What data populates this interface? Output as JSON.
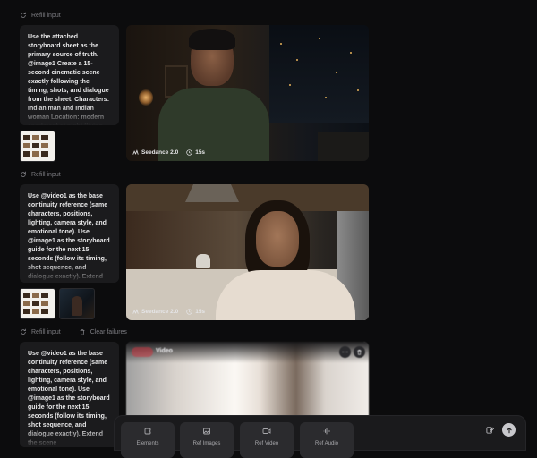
{
  "refill_label": "Refill input",
  "clear_failures_label": "Clear failures",
  "generations": [
    {
      "prompt": "Use the attached storyboard sheet as the primary source of truth. @image1 Create a 15-second cinematic scene exactly following the timing, shots, and dialogue from the sheet. Characters: Indian man and Indian woman Location: modern apartment at night (living room +",
      "model": "Seedance 2.0",
      "duration": "15s"
    },
    {
      "prompt": "Use @video1 as the base continuity reference (same characters, positions, lighting, camera style, and emotional tone). Use @image1 as the storyboard guide for the next 15 seconds (follow its timing, shot sequence, and dialogue exactly). Extend the scene",
      "model": "Seedance 2.0",
      "duration": "15s"
    },
    {
      "prompt": "Use @video1 as the base continuity reference (same characters, positions, lighting, camera style, and emotional tone). Use @image1 as the storyboard guide for the next 15 seconds (follow its timing, shot sequence, and dialogue exactly). Extend the scene",
      "status_label": "Video"
    }
  ],
  "dock": {
    "buttons": [
      {
        "label": "Elements",
        "icon": "elements-icon"
      },
      {
        "label": "Ref Images",
        "icon": "image-icon"
      },
      {
        "label": "Ref Video",
        "icon": "video-icon"
      },
      {
        "label": "Ref Audio",
        "icon": "audio-icon"
      }
    ]
  },
  "colors": {
    "background": "#0c0c0d",
    "card": "#1b1b1d",
    "status_pill": "#c8343f"
  }
}
